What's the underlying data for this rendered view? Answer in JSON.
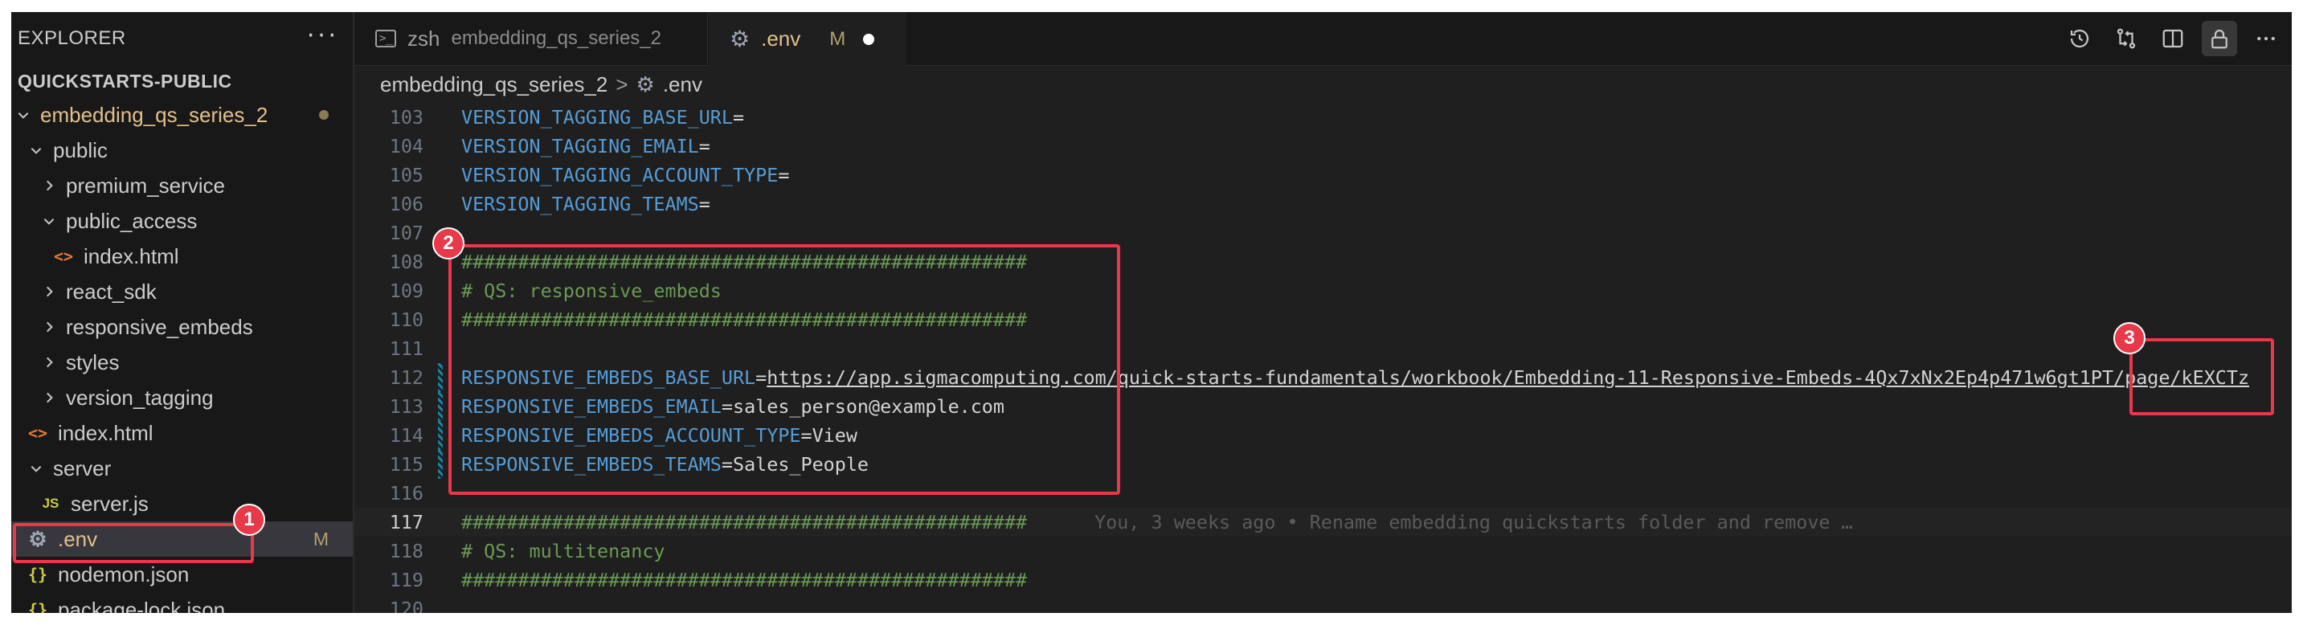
{
  "sidebar": {
    "title": "EXPLORER",
    "more": "···",
    "section": "QUICKSTARTS-PUBLIC",
    "items": [
      {
        "label": "embedding_qs_series_2",
        "icon": "chevron-down-icon",
        "modified": true
      },
      {
        "label": "public",
        "icon": "chevron-down-icon"
      },
      {
        "label": "premium_service",
        "icon": "chevron-right-icon"
      },
      {
        "label": "public_access",
        "icon": "chevron-down-icon"
      },
      {
        "label": "index.html",
        "icon": "html-file-icon",
        "glyph": "<>"
      },
      {
        "label": "react_sdk",
        "icon": "chevron-right-icon"
      },
      {
        "label": "responsive_embeds",
        "icon": "chevron-right-icon"
      },
      {
        "label": "styles",
        "icon": "chevron-right-icon"
      },
      {
        "label": "version_tagging",
        "icon": "chevron-right-icon"
      },
      {
        "label": "index.html",
        "icon": "html-file-icon",
        "glyph": "<>"
      },
      {
        "label": "server",
        "icon": "chevron-down-icon"
      },
      {
        "label": "server.js",
        "icon": "js-file-icon",
        "glyph": "JS"
      },
      {
        "label": ".env",
        "icon": "gear-icon",
        "badge": "M"
      },
      {
        "label": "nodemon.json",
        "icon": "json-file-icon",
        "glyph": "{}"
      },
      {
        "label": "package-lock.json",
        "icon": "json-file-icon",
        "glyph": "{}"
      }
    ]
  },
  "tabs": [
    {
      "label": "zsh",
      "description": "embedding_qs_series_2",
      "icon": "terminal-icon"
    },
    {
      "label": ".env",
      "badge": "M",
      "icon": "gear-icon",
      "dirty": true
    }
  ],
  "breadcrumb": {
    "folder": "embedding_qs_series_2",
    "sep": ">",
    "file": ".env"
  },
  "editor": {
    "lines": [
      {
        "n": "103",
        "key": "VERSION_TAGGING_BASE_URL",
        "value": ""
      },
      {
        "n": "104",
        "key": "VERSION_TAGGING_EMAIL",
        "value": ""
      },
      {
        "n": "105",
        "key": "VERSION_TAGGING_ACCOUNT_TYPE",
        "value": ""
      },
      {
        "n": "106",
        "key": "VERSION_TAGGING_TEAMS",
        "value": ""
      },
      {
        "n": "107"
      },
      {
        "n": "108",
        "comment": "##################################################"
      },
      {
        "n": "109",
        "comment": "# QS: responsive_embeds"
      },
      {
        "n": "110",
        "comment": "##################################################"
      },
      {
        "n": "111"
      },
      {
        "n": "112",
        "key": "RESPONSIVE_EMBEDS_BASE_URL",
        "value": "https://app.sigmacomputing.com/quick-starts-fundamentals/workbook/Embedding-11-Responsive-Embeds-4Qx7xNx2Ep4p471w6gt1PT/page/kEXCTz"
      },
      {
        "n": "113",
        "key": "RESPONSIVE_EMBEDS_EMAIL",
        "value": "sales_person@example.com"
      },
      {
        "n": "114",
        "key": "RESPONSIVE_EMBEDS_ACCOUNT_TYPE",
        "value": "View"
      },
      {
        "n": "115",
        "key": "RESPONSIVE_EMBEDS_TEAMS",
        "value": "Sales_People"
      },
      {
        "n": "116"
      },
      {
        "n": "117",
        "comment": "##################################################",
        "blame": "You, 3 weeks ago • Rename embedding quickstarts folder and remove …"
      },
      {
        "n": "118",
        "comment": "# QS: multitenancy"
      },
      {
        "n": "119",
        "comment": "##################################################"
      },
      {
        "n": "120"
      }
    ]
  },
  "annotations": [
    "1",
    "2",
    "3"
  ],
  "colors": {
    "annotation": "#e8394a",
    "key": "#569cd6",
    "comment": "#6a9955",
    "modified": "#e2c08d"
  }
}
